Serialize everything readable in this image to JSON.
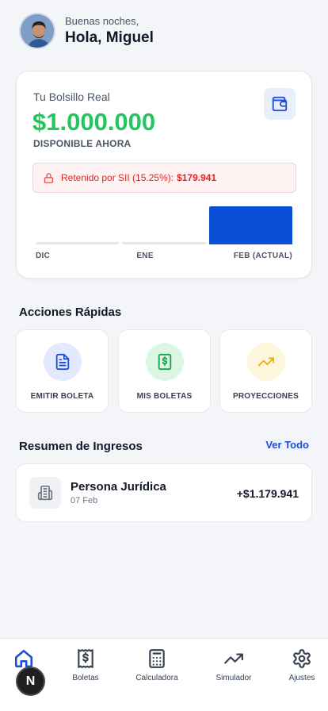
{
  "header": {
    "greeting": "Buenas noches,",
    "name": "Hola, Miguel"
  },
  "balance_card": {
    "title": "Tu Bolsillo Real",
    "amount": "$1.000.000",
    "subtitle": "DISPONIBLE AHORA",
    "retenido_label": "Retenido por SII (15.25%):",
    "retenido_amount": "$179.941",
    "chart_data": {
      "type": "bar",
      "categories": [
        "DIC",
        "ENE",
        "FEB (ACTUAL)"
      ],
      "values": [
        0,
        0,
        1179941
      ],
      "colors": [
        "#e5e7eb",
        "#e5e7eb",
        "#0b4fd6"
      ]
    }
  },
  "quick_actions": {
    "title": "Acciones Rápidas",
    "items": [
      {
        "label": "EMITIR BOLETA",
        "icon": "document-icon",
        "bg": "#e3eafb",
        "color": "#1d4ed8"
      },
      {
        "label": "MIS BOLETAS",
        "icon": "dollar-receipt-icon",
        "bg": "#dcf5e5",
        "color": "#16a34a"
      },
      {
        "label": "PROYECCIONES",
        "icon": "trending-up-icon",
        "bg": "#fef6dc",
        "color": "#eab308"
      }
    ]
  },
  "income_summary": {
    "title": "Resumen de Ingresos",
    "see_all": "Ver Todo",
    "items": [
      {
        "name": "Persona Jurídica",
        "date": "07 Feb",
        "amount": "+$1.179.941",
        "icon": "building-icon"
      }
    ]
  },
  "nav": {
    "items": [
      {
        "label": "Inicio",
        "icon": "home-icon",
        "active": true
      },
      {
        "label": "Boletas",
        "icon": "receipt-icon"
      },
      {
        "label": "Calculadora",
        "icon": "calculator-icon"
      },
      {
        "label": "Simulador",
        "icon": "trending-up-icon"
      },
      {
        "label": "Ajustes",
        "icon": "gear-icon"
      }
    ]
  },
  "fab": {
    "label": "N"
  },
  "colors": {
    "accent": "#1d4ed8",
    "positive": "#22c55e",
    "danger": "#dc2626"
  }
}
